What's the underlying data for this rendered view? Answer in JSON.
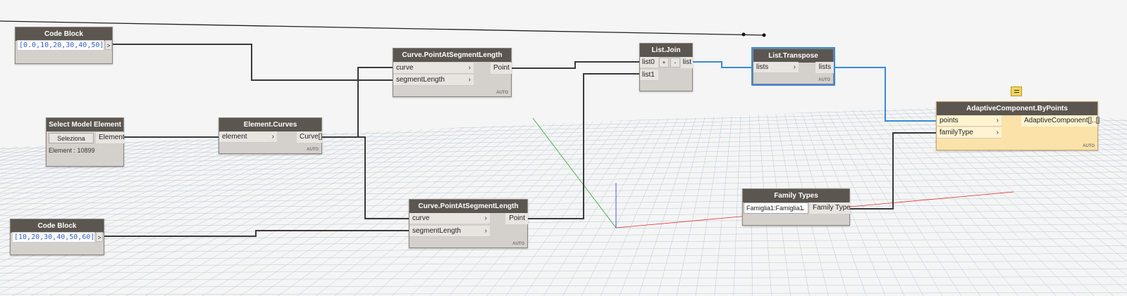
{
  "nodes": {
    "code_block_1": {
      "title": "Code Block",
      "code": "[0.0,10,20,30,40,50];",
      "out_label": ">"
    },
    "code_block_2": {
      "title": "Code Block",
      "code": "[10,20,30,40,50,60];",
      "out_label": ">"
    },
    "select_model": {
      "title": "Select Model Element",
      "button": "Seleziona",
      "output": "Element",
      "status": "Element : 10899"
    },
    "element_curves": {
      "title": "Element.Curves",
      "input": "element",
      "output": "Curve[]",
      "lacing": "AUTO"
    },
    "point_at_seg_1": {
      "title": "Curve.PointAtSegmentLength",
      "inputs": [
        "curve",
        "segmentLength"
      ],
      "output": "Point",
      "lacing": "AUTO"
    },
    "point_at_seg_2": {
      "title": "Curve.PointAtSegmentLength",
      "inputs": [
        "curve",
        "segmentLength"
      ],
      "output": "Point",
      "lacing": "AUTO"
    },
    "list_join": {
      "title": "List.Join",
      "inputs": [
        "list0",
        "list1"
      ],
      "plus": "+",
      "minus": "-",
      "output": "list"
    },
    "list_transpose": {
      "title": "List.Transpose",
      "input": "lists",
      "output": "lists",
      "lacing": "AUTO"
    },
    "adaptive": {
      "title": "AdaptiveComponent.ByPoints",
      "inputs": [
        "points",
        "familyType"
      ],
      "output": "AdaptiveComponent[]..[]",
      "lacing": "AUTO"
    },
    "family_types": {
      "title": "Family Types",
      "selected": "Famiglia1:Famiglia1",
      "output": "Family Type"
    }
  },
  "colors": {
    "wire": "#3a3a3a",
    "selected_wire": "#3a8ad8",
    "node_title": "#5c5650",
    "node_body": "#d4d0cb",
    "yellow_node": "#fbe2a8",
    "grid": "#b8c8d4",
    "axis_x": "#e03030",
    "axis_y": "#30a030",
    "axis_z": "#3030e0"
  }
}
